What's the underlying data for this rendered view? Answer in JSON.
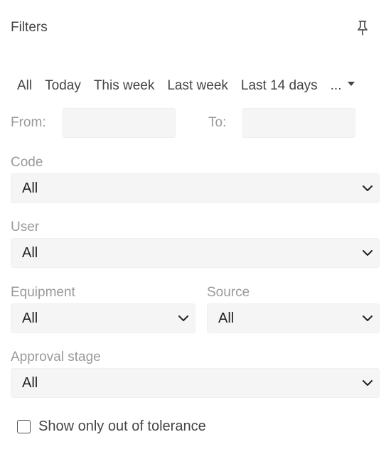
{
  "panel": {
    "title": "Filters"
  },
  "icons": {
    "pin": "pin-icon",
    "chevron": "chevron-down-icon",
    "caret": "caret-down-icon"
  },
  "date_range": {
    "tabs": [
      "All",
      "Today",
      "This week",
      "Last week",
      "Last 14 days"
    ],
    "more_label": "...",
    "from_label": "From:",
    "from_value": "",
    "to_label": "To:",
    "to_value": ""
  },
  "filters": {
    "code": {
      "label": "Code",
      "value": "All"
    },
    "user": {
      "label": "User",
      "value": "All"
    },
    "equipment": {
      "label": "Equipment",
      "value": "All"
    },
    "source": {
      "label": "Source",
      "value": "All"
    },
    "approval_stage": {
      "label": "Approval stage",
      "value": "All"
    }
  },
  "tolerance": {
    "label": "Show only out of tolerance",
    "checked": false
  },
  "colors": {
    "field_bg": "#f5f5f5",
    "label": "#9a9a9a",
    "text": "#222222"
  }
}
